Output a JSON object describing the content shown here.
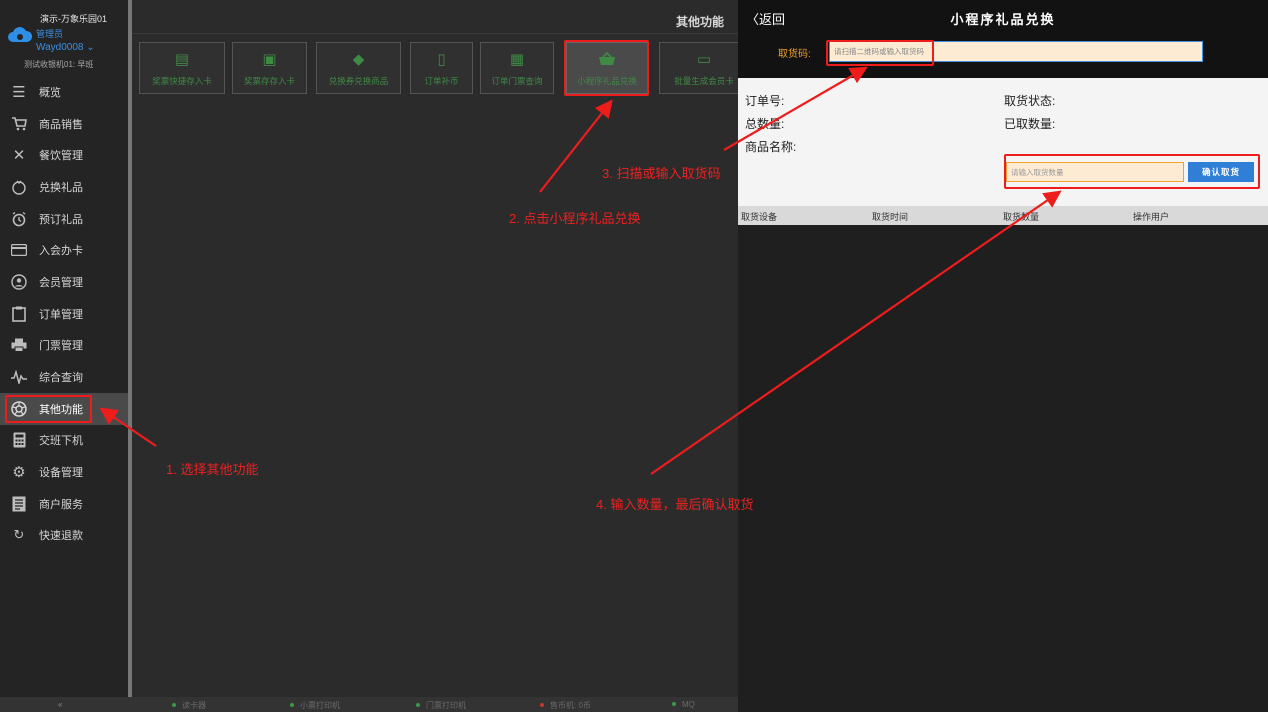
{
  "left": {
    "brand": {
      "name": "演示-万象乐园01",
      "role": "管理员",
      "user": "Wayd0008 ⌄",
      "device": "测试收银机01: 早班"
    },
    "nav": [
      {
        "label": "概览",
        "icon": "menu-icon"
      },
      {
        "label": "商品销售",
        "icon": "cart-icon"
      },
      {
        "label": "餐饮管理",
        "icon": "utensils-icon"
      },
      {
        "label": "兑换礼品",
        "icon": "gift-icon"
      },
      {
        "label": "预订礼品",
        "icon": "alarm-clock-icon"
      },
      {
        "label": "入会办卡",
        "icon": "card-icon"
      },
      {
        "label": "会员管理",
        "icon": "member-icon"
      },
      {
        "label": "订单管理",
        "icon": "clipboard-icon"
      },
      {
        "label": "门票管理",
        "icon": "printer-icon"
      },
      {
        "label": "综合查询",
        "icon": "pulse-icon"
      },
      {
        "label": "其他功能",
        "icon": "aperture-icon"
      },
      {
        "label": "交班下机",
        "icon": "calculator-icon"
      },
      {
        "label": "设备管理",
        "icon": "gear-icon"
      },
      {
        "label": "商户服务",
        "icon": "document-icon"
      },
      {
        "label": "快速退款",
        "icon": "refresh-icon"
      }
    ],
    "main_title": "其他功能",
    "tiles": [
      {
        "label": "奖票快捷存入卡",
        "icon": "list-icon"
      },
      {
        "label": "奖票存存入卡",
        "icon": "ticket-icon"
      },
      {
        "label": "兑换券兑换商品",
        "icon": "tag-icon"
      },
      {
        "label": "订单补币",
        "icon": "clipboard-icon"
      },
      {
        "label": "订单门票查询",
        "icon": "document-icon"
      },
      {
        "label": "小程序礼品兑换",
        "icon": "basket-icon"
      },
      {
        "label": "批量生成会员卡",
        "icon": "card-icon"
      }
    ],
    "status": [
      {
        "label": "读卡器",
        "state": "ok"
      },
      {
        "label": "小票打印机",
        "state": "ok"
      },
      {
        "label": "门票打印机",
        "state": "ok"
      },
      {
        "label": "售币机: 0币",
        "state": "error"
      },
      {
        "label": "MQ",
        "state": "ok"
      }
    ],
    "collapse": "«"
  },
  "right": {
    "back": "〈返回",
    "title": "小程序礼品兑换",
    "code_label": "取货码:",
    "code_placeholder": "请扫描二维码或输入取货码",
    "info": {
      "order_no": "订单号:",
      "total_qty": "总数量:",
      "product_name": "商品名称:",
      "status": "取货状态:",
      "taken_qty": "已取数量:"
    },
    "qty_placeholder": "请输入取货数量",
    "confirm": "确认取货",
    "table_headers": [
      "取货设备",
      "取货时间",
      "取货数量",
      "操作用户"
    ]
  },
  "annotations": {
    "step1": "1. 选择其他功能",
    "step2": "2. 点击小程序礼品兑换",
    "step3": "3. 扫描或输入取货码",
    "step4": "4. 输入数量，最后确认取货",
    "color": "#ef1c1c"
  },
  "colors": {
    "accent_blue": "#2f7fd6",
    "tile_green": "#3f8a45",
    "label_orange": "#f0a22e"
  }
}
